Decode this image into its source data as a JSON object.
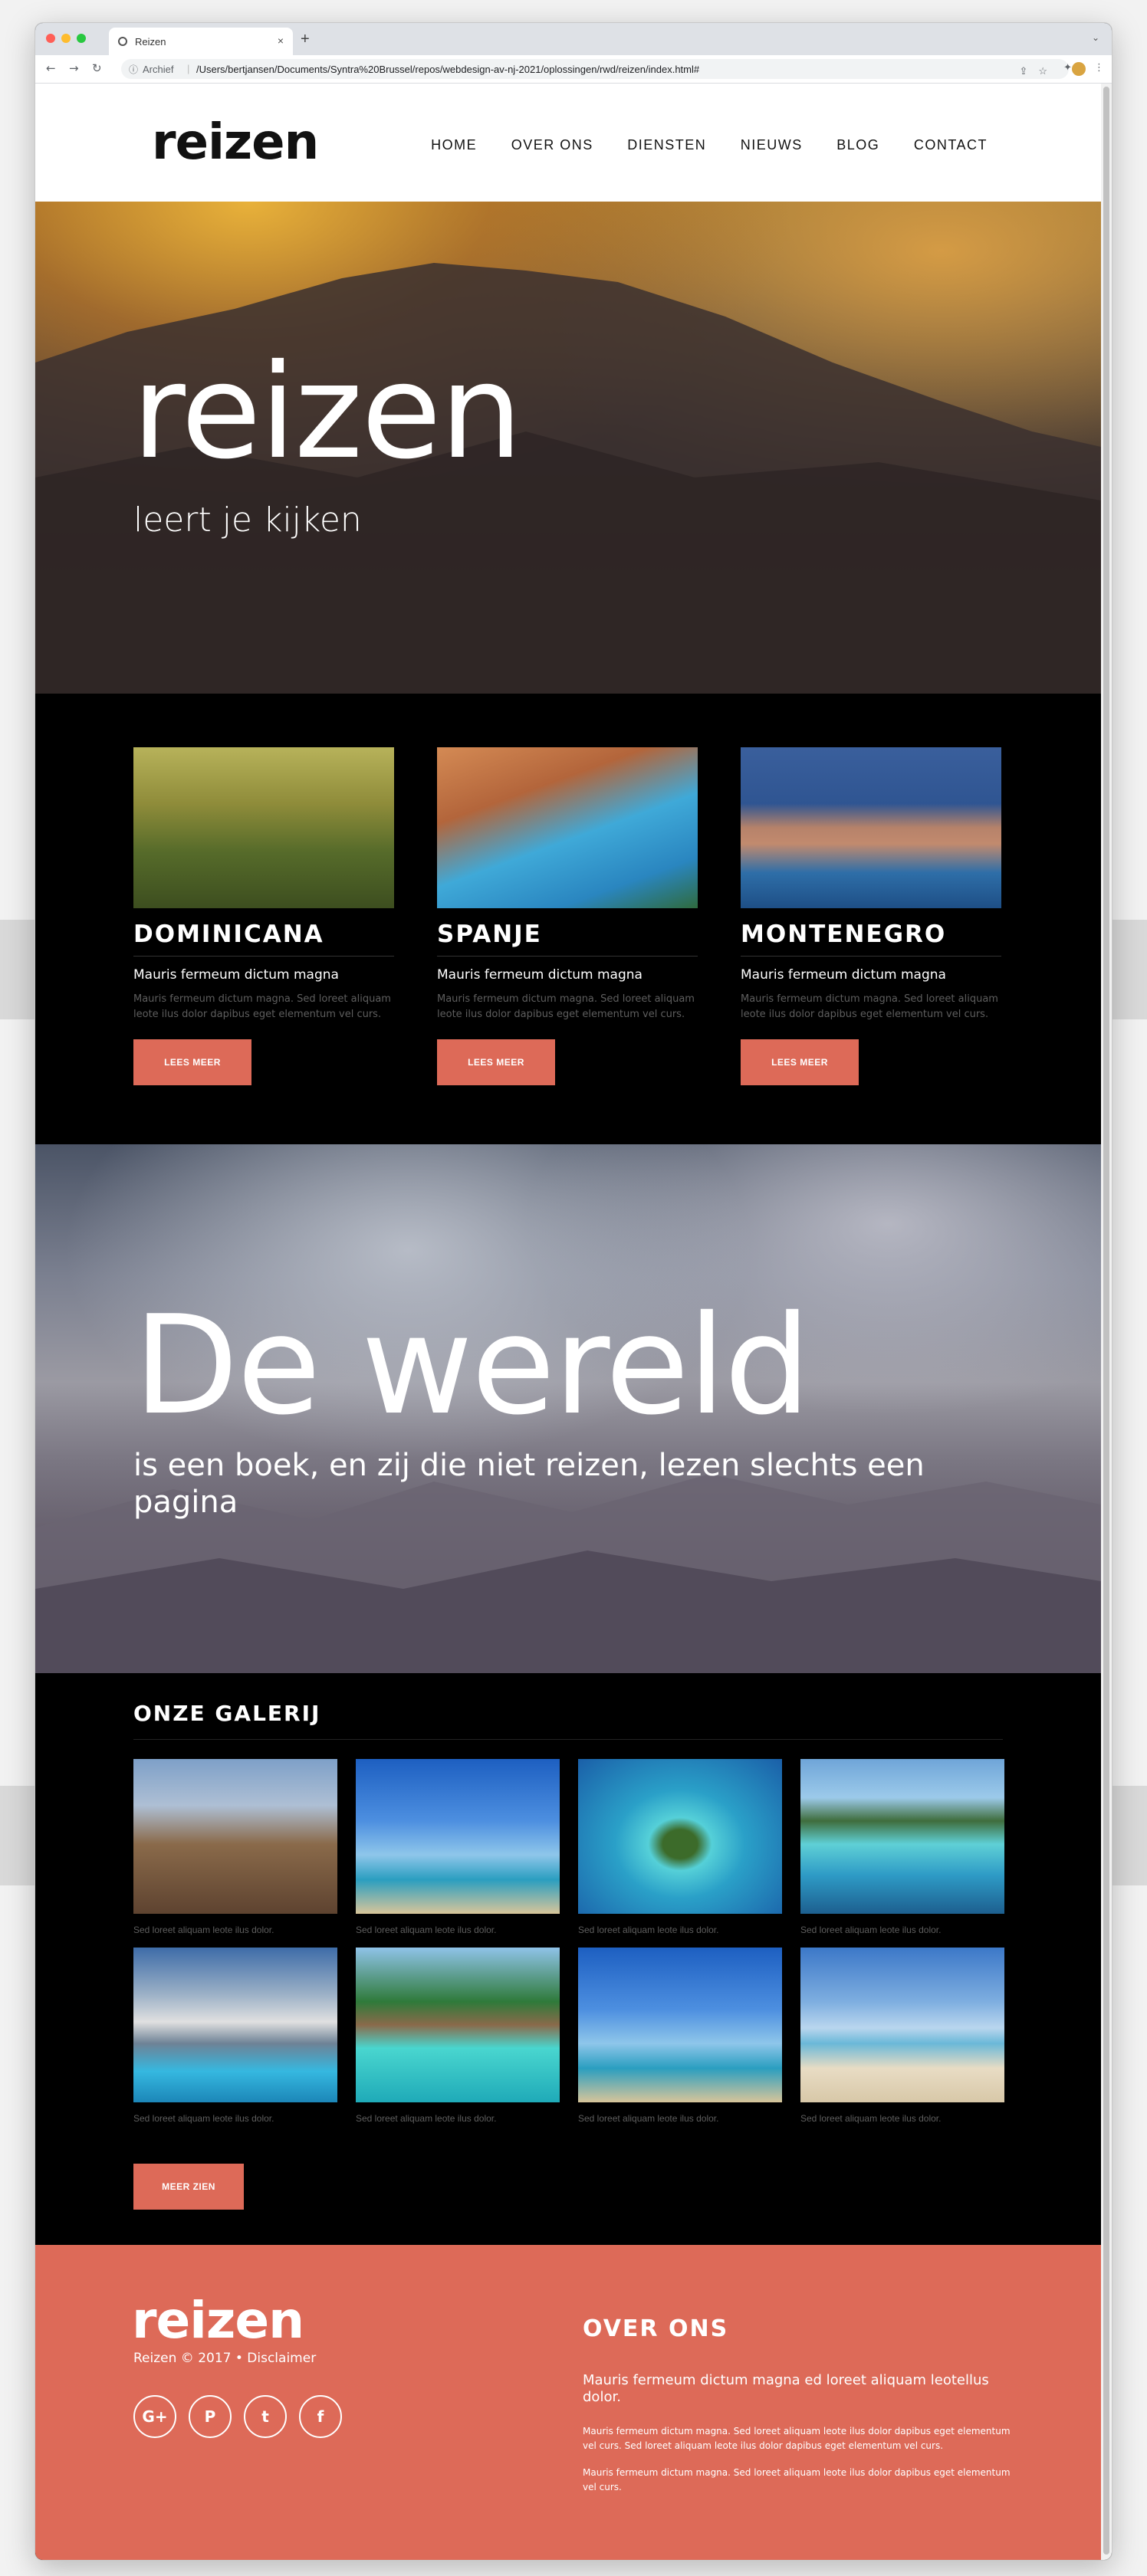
{
  "browser": {
    "tab_title": "Reizen",
    "tab_close": "×",
    "new_tab": "+",
    "tab_menu": "⌄",
    "archief_label": "Archief",
    "url": "/Users/bertjansen/Documents/Syntra%20Brussel/repos/webdesign-av-nj-2021/oplossingen/rwd/reizen/index.html#",
    "back": "←",
    "forward": "→",
    "reload": "↻",
    "menu": "⋮"
  },
  "header": {
    "logo": "reizen",
    "nav": [
      "HOME",
      "OVER ONS",
      "DIENSTEN",
      "NIEUWS",
      "BLOG",
      "CONTACT"
    ]
  },
  "hero1": {
    "title": "reizen",
    "subtitle": "leert je kijken"
  },
  "destinations": [
    {
      "title": "DOMINICANA",
      "subtitle": "Mauris fermeum dictum magna",
      "text": "Mauris fermeum dictum magna. Sed loreet aliquam leote ilus dolor dapibus eget elementum vel curs.",
      "button": "LEES MEER"
    },
    {
      "title": "SPANJE",
      "subtitle": "Mauris fermeum dictum magna",
      "text": "Mauris fermeum dictum magna. Sed loreet aliquam leote ilus dolor dapibus eget elementum vel curs.",
      "button": "LEES MEER"
    },
    {
      "title": "MONTENEGRO",
      "subtitle": "Mauris fermeum dictum magna",
      "text": "Mauris fermeum dictum magna. Sed loreet aliquam leote ilus dolor dapibus eget elementum vel curs.",
      "button": "LEES MEER"
    }
  ],
  "hero2": {
    "title": "De wereld",
    "subtitle": "is een boek, en zij die niet reizen, lezen slechts een pagina"
  },
  "gallery": {
    "title": "ONZE GALERIJ",
    "captions": [
      "Sed loreet aliquam leote ilus dolor.",
      "Sed loreet aliquam leote ilus dolor.",
      "Sed loreet aliquam leote ilus dolor.",
      "Sed loreet aliquam leote ilus dolor.",
      "Sed loreet aliquam leote ilus dolor.",
      "Sed loreet aliquam leote ilus dolor.",
      "Sed loreet aliquam leote ilus dolor.",
      "Sed loreet aliquam leote ilus dolor."
    ],
    "button": "MEER ZIEN"
  },
  "footer": {
    "logo": "reizen",
    "copyright": "Reizen © 2017 • Disclaimer",
    "social": [
      "G+",
      "P",
      "t",
      "f"
    ],
    "about_title": "OVER ONS",
    "about_lead": "Mauris fermeum dictum magna ed loreet aliquam leotellus dolor.",
    "about_p1": "Mauris fermeum dictum magna. Sed loreet aliquam leote ilus dolor dapibus eget elementum vel curs. Sed loreet aliquam leote ilus dolor dapibus eget elementum vel curs.",
    "about_p2": "Mauris fermeum dictum magna. Sed loreet aliquam leote ilus dolor dapibus eget elementum vel curs."
  },
  "colors": {
    "accent": "#dd6a58",
    "background": "#000000",
    "header_bg": "#ffffff"
  }
}
